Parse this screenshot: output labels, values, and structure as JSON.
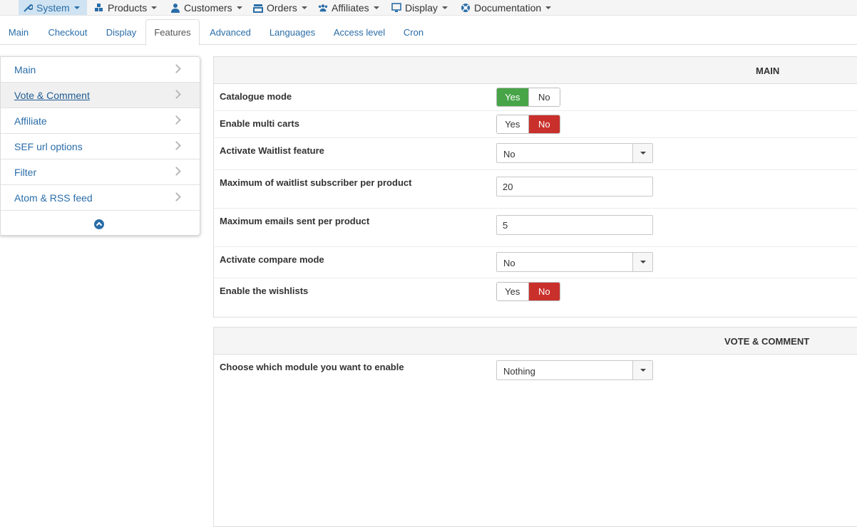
{
  "menubar": {
    "items": [
      {
        "label": "System",
        "icon": "wrench-icon"
      },
      {
        "label": "Products",
        "icon": "cubes-icon"
      },
      {
        "label": "Customers",
        "icon": "user-icon"
      },
      {
        "label": "Orders",
        "icon": "orders-icon"
      },
      {
        "label": "Affiliates",
        "icon": "users-icon"
      },
      {
        "label": "Display",
        "icon": "monitor-icon"
      },
      {
        "label": "Documentation",
        "icon": "lifebuoy-icon"
      }
    ],
    "active": "System"
  },
  "tabs": {
    "items": [
      "Main",
      "Checkout",
      "Display",
      "Features",
      "Advanced",
      "Languages",
      "Access level",
      "Cron"
    ],
    "active": "Features"
  },
  "sidebar": {
    "items": [
      "Main",
      "Vote & Comment",
      "Affiliate",
      "SEF url options",
      "Filter",
      "Atom & RSS feed"
    ],
    "active": "Vote & Comment"
  },
  "main_panel": {
    "title": "MAIN",
    "rows": [
      {
        "label": "Catalogue mode",
        "type": "toggle",
        "yes": "Yes",
        "no": "No",
        "value": "Yes"
      },
      {
        "label": "Enable multi carts",
        "type": "toggle",
        "yes": "Yes",
        "no": "No",
        "value": "No"
      },
      {
        "label": "Activate Waitlist feature",
        "type": "select",
        "value": "No"
      },
      {
        "label": "Maximum of waitlist subscriber per product",
        "type": "text",
        "value": "20"
      },
      {
        "label": "Maximum emails sent per product",
        "type": "text",
        "value": "5"
      },
      {
        "label": "Activate compare mode",
        "type": "select",
        "value": "No"
      },
      {
        "label": "Enable the wishlists",
        "type": "toggle",
        "yes": "Yes",
        "no": "No",
        "value": "No"
      }
    ]
  },
  "vote_panel": {
    "title": "VOTE & COMMENT",
    "rows": [
      {
        "label": "Choose which module you want to enable",
        "type": "select",
        "value": "Nothing"
      }
    ]
  },
  "colors": {
    "accent": "#2a6da8",
    "toggle_yes": "#47a447",
    "toggle_no": "#c9302c"
  }
}
